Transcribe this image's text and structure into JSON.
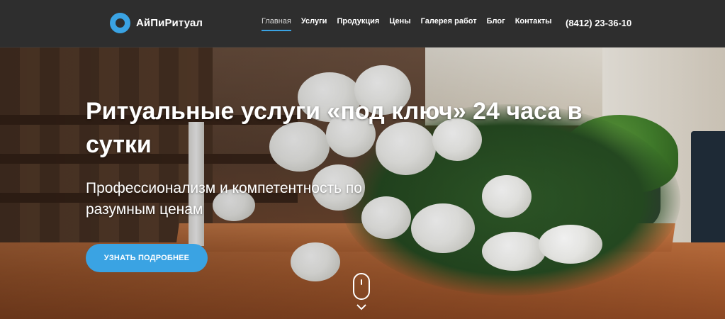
{
  "brand": {
    "name": "АйПиРитуал",
    "accent_color": "#3aa3e3"
  },
  "nav": {
    "items": [
      {
        "label": "Главная",
        "active": true
      },
      {
        "label": "Услуги",
        "active": false
      },
      {
        "label": "Продукция",
        "active": false
      },
      {
        "label": "Цены",
        "active": false
      },
      {
        "label": "Галерея работ",
        "active": false
      },
      {
        "label": "Блог",
        "active": false
      },
      {
        "label": "Контакты",
        "active": false
      }
    ]
  },
  "header": {
    "phone": "(8412) 23-36-10"
  },
  "hero": {
    "title": "Ритуальные услуги «под ключ» 24 часа в сутки",
    "subtitle": "Профессионализм и компетентность по разумным ценам",
    "cta_label": "УЗНАТЬ ПОДРОБНЕЕ",
    "background_icon": "funeral-flowers-image",
    "scroll_icon": "mouse-scroll-icon",
    "chevron_icon": "chevron-down-icon"
  }
}
